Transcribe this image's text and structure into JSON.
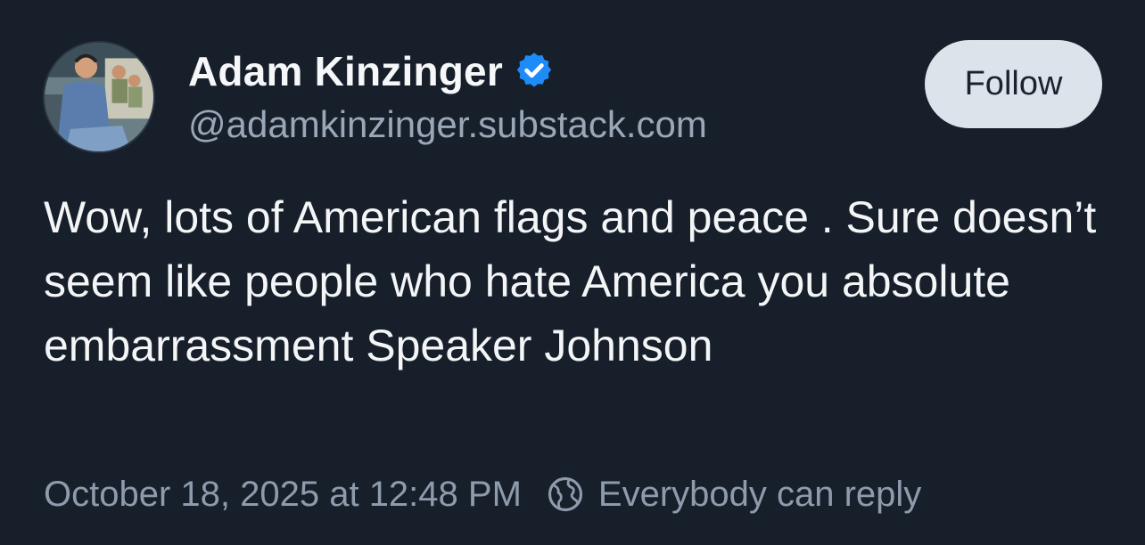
{
  "author": {
    "display_name": "Adam Kinzinger",
    "handle": "@adamkinzinger.substack.com",
    "verified": true,
    "verified_color": "#1d8cf8"
  },
  "actions": {
    "follow_label": "Follow"
  },
  "post": {
    "text": "Wow, lots of American flags and peace . Sure doesn’t seem like people who hate America you absolute embarrassment Speaker Johnson"
  },
  "meta": {
    "timestamp": "October 18, 2025 at 12:48 PM",
    "reply_setting": "Everybody can reply",
    "reply_icon": "globe-icon"
  },
  "colors": {
    "background": "#171f2a",
    "text": "#f3f5f7",
    "muted": "#9aa7b8",
    "follow_button_bg": "#dde3ea"
  }
}
